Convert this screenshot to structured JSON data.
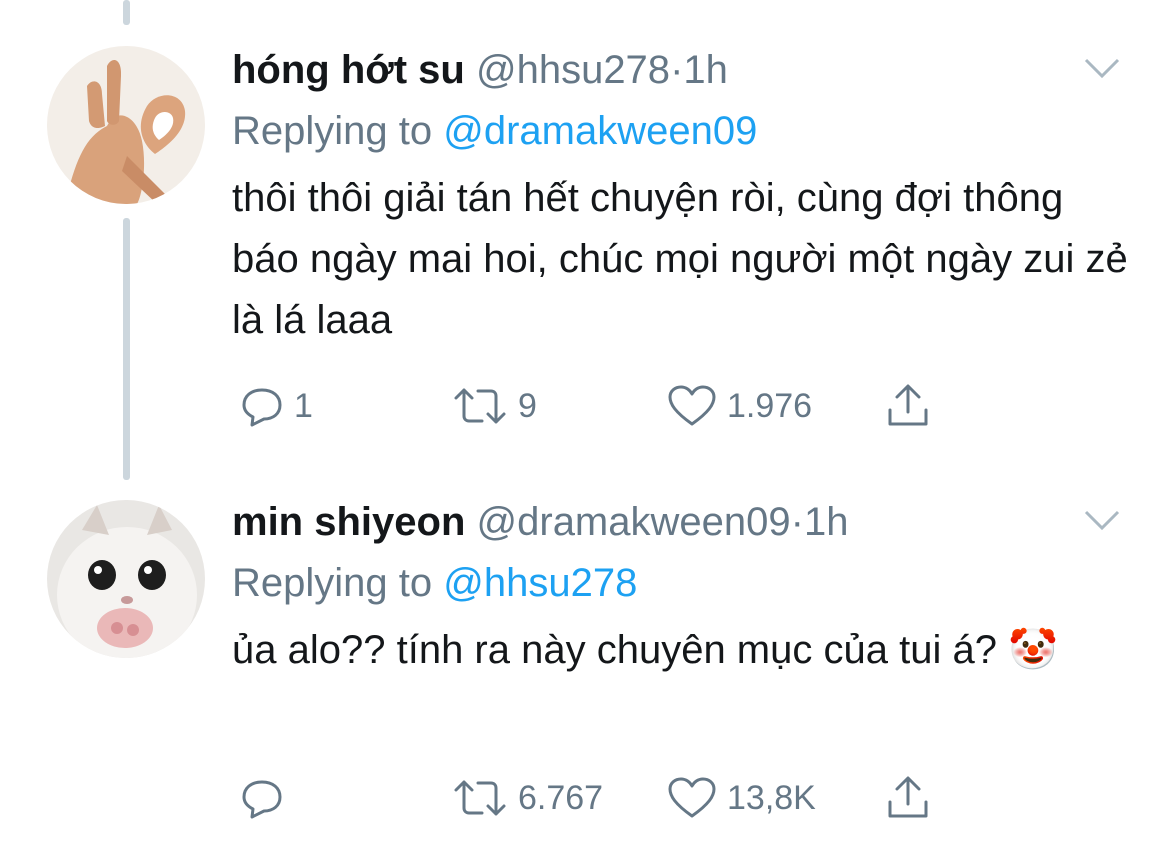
{
  "tweets": [
    {
      "name": "hóng hớt su",
      "handle": "@hhsu278",
      "separator": "·",
      "time": "1h",
      "replying_prefix": "Replying to",
      "replying_to": "@dramakween09",
      "text": "thôi thôi giải tán hết chuyện ròi, cùng đợi thông báo ngày mai hoi, chúc mọi người một ngày zui zẻ là lá laaa",
      "reply_count": "1",
      "retweet_count": "9",
      "like_count": "1.976"
    },
    {
      "name": "min shiyeon",
      "handle": "@dramakween09",
      "separator": "·",
      "time": "1h",
      "replying_prefix": "Replying to",
      "replying_to": "@hhsu278",
      "text": "ủa alo?? tính ra này chuyên mục của tui á?",
      "emoji": "🤡",
      "reply_count": "",
      "retweet_count": "6.767",
      "like_count": "13,8K"
    }
  ],
  "colors": {
    "accent": "#1da1f2",
    "muted": "#657786",
    "text": "#14171a",
    "thread_line": "#ccd6dd"
  },
  "icons": [
    "reply-icon",
    "retweet-icon",
    "like-icon",
    "share-icon",
    "chevron-down-icon"
  ]
}
